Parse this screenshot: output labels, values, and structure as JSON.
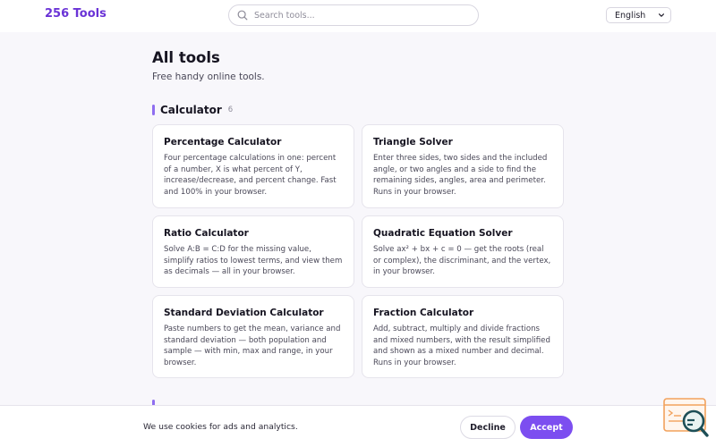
{
  "header": {
    "logo": "256 Tools",
    "search_placeholder": "Search tools...",
    "language": "English"
  },
  "main": {
    "title": "All tools",
    "subtitle": "Free handy online tools.",
    "section": {
      "title": "Calculator",
      "count": "6"
    },
    "tools": [
      {
        "title": "Percentage Calculator",
        "description": "Four percentage calculations in one: percent of a number, X is what percent of Y, increase/decrease, and percent change. Fast and 100% in your browser."
      },
      {
        "title": "Triangle Solver",
        "description": "Enter three sides, two sides and the included angle, or two angles and a side to find the remaining sides, angles, area and perimeter. Runs in your browser."
      },
      {
        "title": "Ratio Calculator",
        "description": "Solve A:B = C:D for the missing value, simplify ratios to lowest terms, and view them as decimals — all in your browser."
      },
      {
        "title": "Quadratic Equation Solver",
        "description": "Solve ax² + bx + c = 0 — get the roots (real or complex), the discriminant, and the vertex, in your browser."
      },
      {
        "title": "Standard Deviation Calculator",
        "description": "Paste numbers to get the mean, variance and standard deviation — both population and sample — with min, max and range, in your browser."
      },
      {
        "title": "Fraction Calculator",
        "description": "Add, subtract, multiply and divide fractions and mixed numbers, with the result simplified and shown as a mixed number and decimal. Runs in your browser."
      }
    ]
  },
  "cookie_bar": {
    "text": "We use cookies for ads and analytics.",
    "decline": "Decline",
    "accept": "Accept"
  },
  "colors": {
    "brand": "#6a33d6",
    "accent": "#7c4ef0"
  }
}
